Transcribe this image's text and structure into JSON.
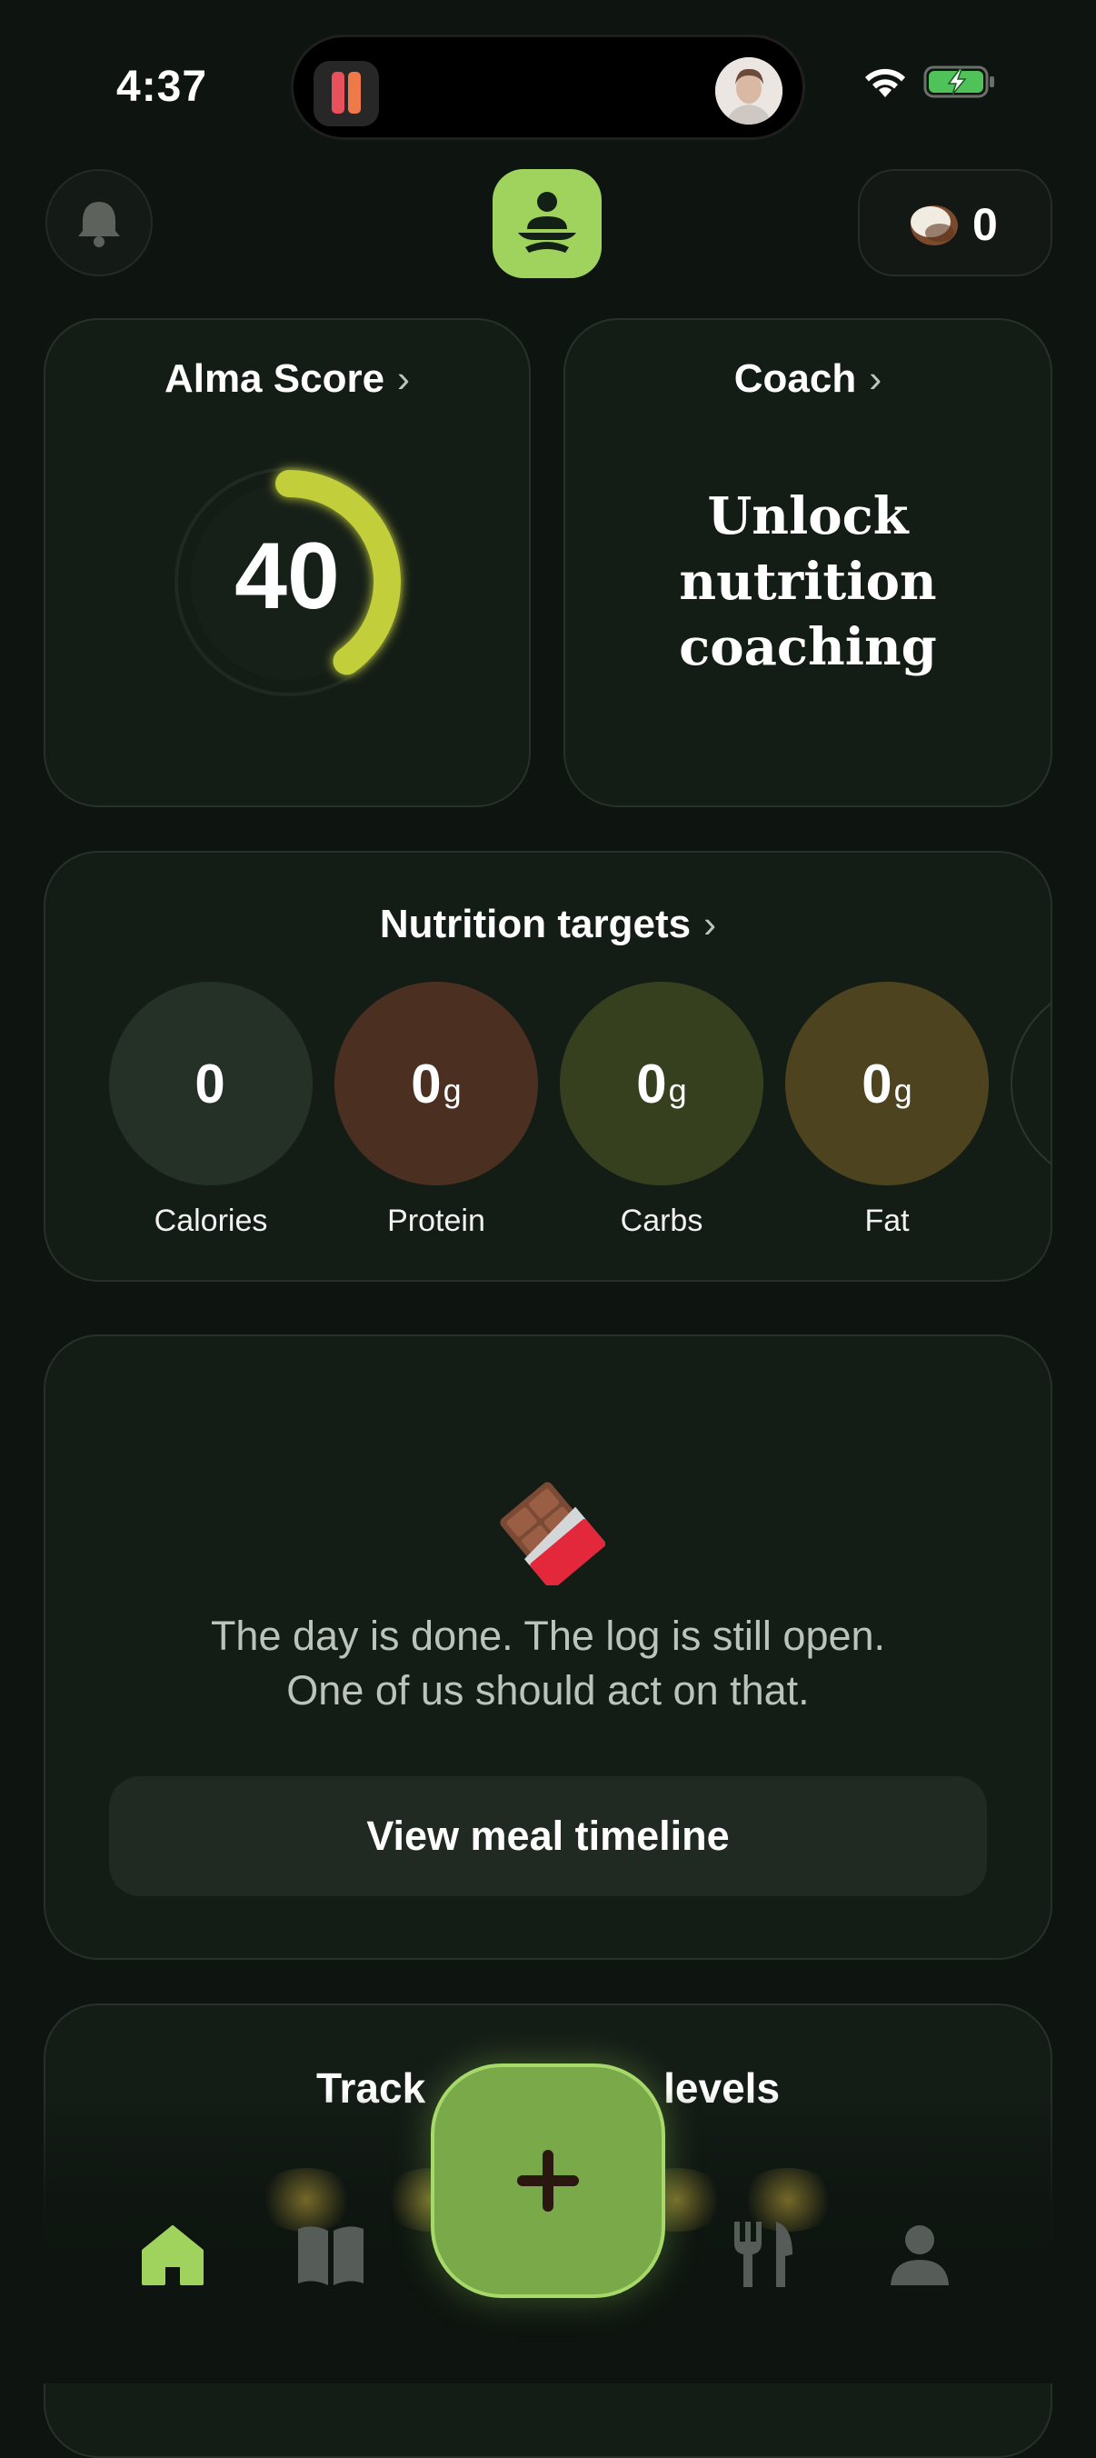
{
  "status_bar": {
    "time": "4:37",
    "icons": [
      "wifi-icon",
      "battery-charging-icon"
    ]
  },
  "header": {
    "bell_icon": "bell-icon",
    "logo_icon": "meditation-logo-icon",
    "coins": "0",
    "coin_icon": "coconut-icon"
  },
  "score_card": {
    "title": "Alma Score",
    "score": "40",
    "progress_fraction": 0.4,
    "ring_color": "#c2cf3a"
  },
  "coach_card": {
    "title": "Coach",
    "body_line1": "Unlock",
    "body_line2": "nutrition",
    "body_line3": "coaching"
  },
  "nutrition": {
    "title": "Nutrition targets",
    "macros": [
      {
        "value": "0",
        "unit": "",
        "label": "Calories",
        "color": "#253027"
      },
      {
        "value": "0",
        "unit": "g",
        "label": "Protein",
        "color": "#4b3022"
      },
      {
        "value": "0",
        "unit": "g",
        "label": "Carbs",
        "color": "#36401f"
      },
      {
        "value": "0",
        "unit": "g",
        "label": "Fat",
        "color": "#4d431f"
      }
    ]
  },
  "message_card": {
    "icon": "chocolate-bar-icon",
    "line1": "The day is done. The log is still open.",
    "line2": "One of us should act on that.",
    "button_label": "View meal timeline"
  },
  "track_card": {
    "title_left": "Track",
    "title_right": "levels"
  },
  "bottom_nav": {
    "items": [
      "home-icon",
      "book-icon",
      "add-icon",
      "utensils-icon",
      "profile-icon"
    ],
    "active": "home-icon",
    "accent": "#9fd35d"
  }
}
